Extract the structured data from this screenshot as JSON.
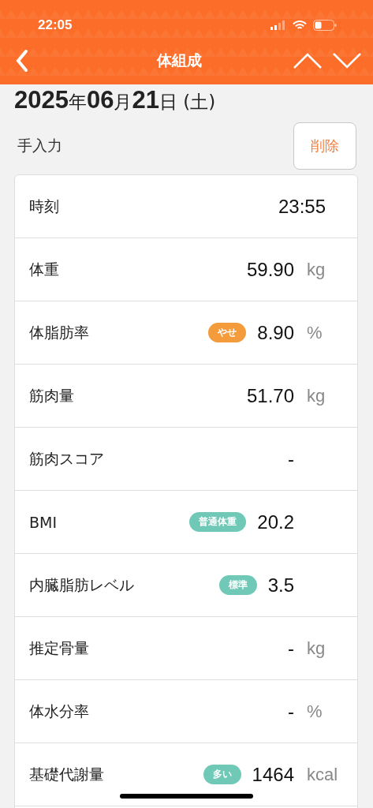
{
  "status_bar": {
    "time": "22:05"
  },
  "nav": {
    "title": "体組成"
  },
  "date": {
    "parts": [
      {
        "text": "2025",
        "kind": "num"
      },
      {
        "text": "年",
        "kind": "unit"
      },
      {
        "text": "06",
        "kind": "num"
      },
      {
        "text": "月",
        "kind": "unit"
      },
      {
        "text": "21",
        "kind": "num"
      },
      {
        "text": "日 (土)",
        "kind": "unit"
      }
    ]
  },
  "source": {
    "label": "手入力",
    "delete_button": "削除"
  },
  "rows": [
    {
      "kind": "time",
      "label": "時刻",
      "value": "23:55"
    },
    {
      "kind": "measure",
      "label": "体重",
      "value": "59.90",
      "unit": "kg"
    },
    {
      "kind": "measure",
      "label": "体脂肪率",
      "badge": {
        "text": "やせ",
        "color": "#f49b3c"
      },
      "value": "8.90",
      "unit": "%"
    },
    {
      "kind": "measure",
      "label": "筋肉量",
      "value": "51.70",
      "unit": "kg"
    },
    {
      "kind": "measure",
      "label": "筋肉スコア",
      "value": "-"
    },
    {
      "kind": "measure",
      "label": "BMI",
      "badge": {
        "text": "普通体重",
        "color": "#6fc9b6"
      },
      "value": "20.2"
    },
    {
      "kind": "measure",
      "label": "内臓脂肪レベル",
      "badge": {
        "text": "標準",
        "color": "#6fc9b6"
      },
      "value": "3.5"
    },
    {
      "kind": "measure",
      "label": "推定骨量",
      "value": "-",
      "unit": "kg"
    },
    {
      "kind": "measure",
      "label": "体水分率",
      "value": "-",
      "unit": "%"
    },
    {
      "kind": "measure",
      "label": "基礎代謝量",
      "badge": {
        "text": "多い",
        "color": "#6fc9b6"
      },
      "value": "1464",
      "unit": "kcal"
    },
    {
      "kind": "empty"
    }
  ]
}
